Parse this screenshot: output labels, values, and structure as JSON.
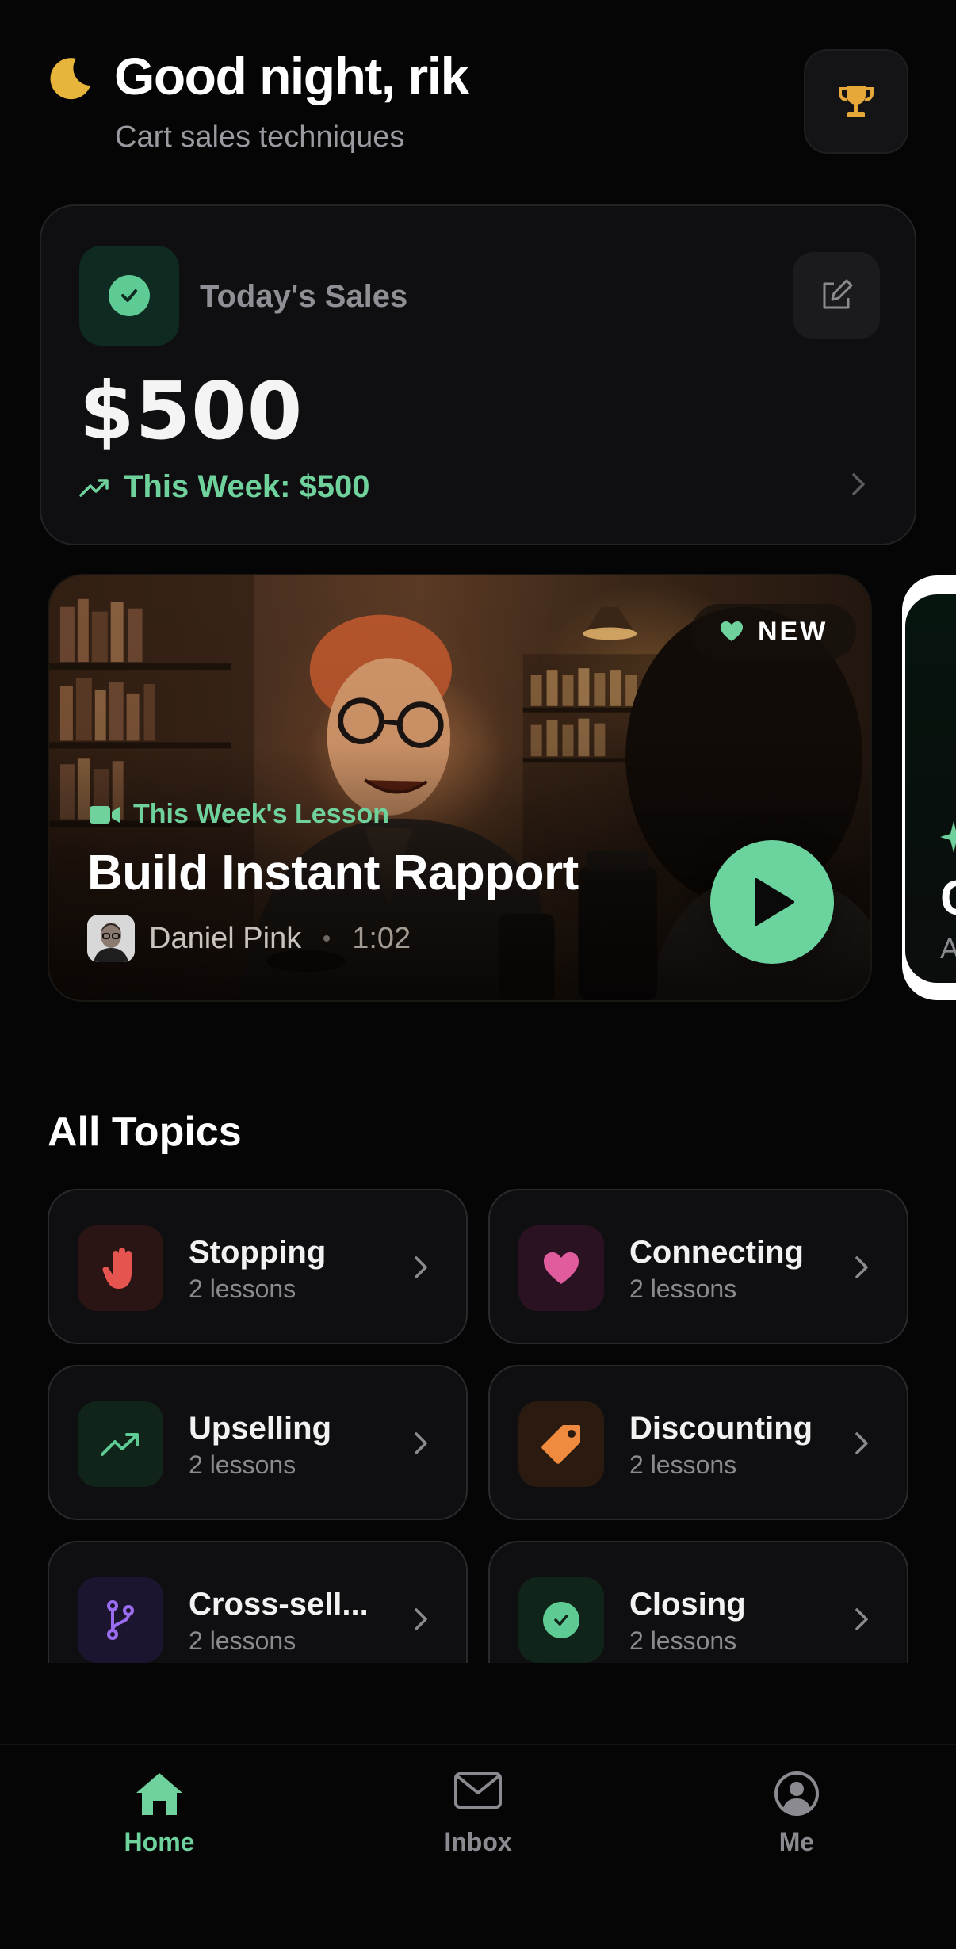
{
  "header": {
    "greeting": "Good night, rik",
    "subtitle": "Cart sales techniques",
    "icons": {
      "greeting": "moon-icon",
      "action": "trophy-icon"
    }
  },
  "sales": {
    "label": "Today's Sales",
    "amount": "$500",
    "week": "This Week: $500",
    "icons": {
      "status": "check-circle-icon",
      "edit": "edit-icon",
      "trend": "trending-up-icon"
    }
  },
  "lesson": {
    "badge": "NEW",
    "kicker": "This Week's Lesson",
    "title": "Build Instant Rapport",
    "author": "Daniel Pink",
    "duration": "1:02"
  },
  "next_lesson": {
    "title_fragment": "C",
    "sub_fragment": "A"
  },
  "topics": {
    "title": "All Topics",
    "items": [
      {
        "name": "Stopping",
        "count": "2 lessons",
        "icon": "hand-icon",
        "color": "#e5544f",
        "bg": "#2a1414"
      },
      {
        "name": "Connecting",
        "count": "2 lessons",
        "icon": "heart-icon",
        "color": "#e05c9c",
        "bg": "#2a1222"
      },
      {
        "name": "Upselling",
        "count": "2 lessons",
        "icon": "trending-up-icon",
        "color": "#5ecb94",
        "bg": "#10241a"
      },
      {
        "name": "Discounting",
        "count": "2 lessons",
        "icon": "tag-icon",
        "color": "#ef8a3f",
        "bg": "#2a1a10"
      },
      {
        "name": "Cross-sell...",
        "count": "2 lessons",
        "icon": "branch-icon",
        "color": "#9b6cf0",
        "bg": "#1c1530"
      },
      {
        "name": "Closing",
        "count": "2 lessons",
        "icon": "check-circle-icon",
        "color": "#5ecb94",
        "bg": "#10241a"
      }
    ]
  },
  "nav": {
    "items": [
      {
        "label": "Home",
        "icon": "home-icon",
        "active": true
      },
      {
        "label": "Inbox",
        "icon": "mail-icon",
        "active": false
      },
      {
        "label": "Me",
        "icon": "user-circle-icon",
        "active": false
      }
    ]
  },
  "colors": {
    "accent": "#6fd29c",
    "background": "#050506",
    "card": "#0f0f11",
    "moon": "#e7b43c",
    "trophy": "#e7a83a",
    "inactive": "#8a8a90"
  }
}
